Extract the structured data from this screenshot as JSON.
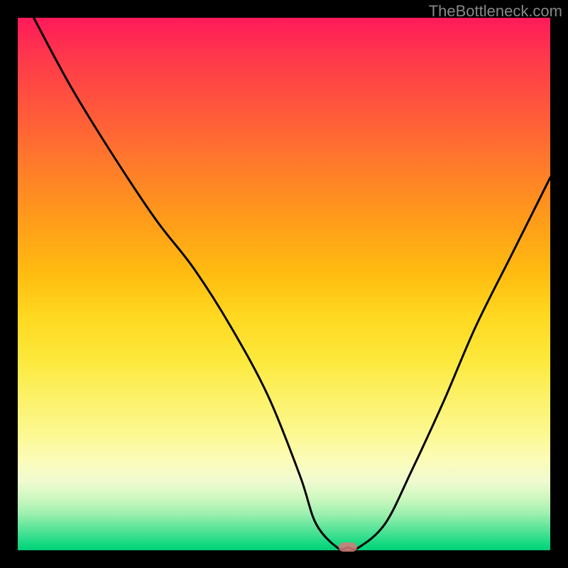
{
  "watermark": "TheBottleneck.com",
  "chart_data": {
    "type": "line",
    "title": "",
    "xlabel": "",
    "ylabel": "",
    "xlim": [
      0,
      100
    ],
    "ylim": [
      0,
      100
    ],
    "series": [
      {
        "name": "bottleneck-curve",
        "x": [
          3,
          10,
          18,
          26,
          33,
          40,
          47,
          53,
          56,
          60,
          62,
          64,
          69,
          74,
          80,
          86,
          93,
          100
        ],
        "values": [
          100,
          87,
          74,
          62,
          53,
          42,
          29,
          14,
          5,
          0.5,
          0.5,
          0.5,
          5,
          15,
          28,
          42,
          56,
          70
        ]
      }
    ],
    "marker": {
      "x": 62,
      "y": 0.5
    },
    "gradient_stops": [
      {
        "pos": 0,
        "color": "#ff1a5a"
      },
      {
        "pos": 18,
        "color": "#ff5a3a"
      },
      {
        "pos": 38,
        "color": "#ff9c1a"
      },
      {
        "pos": 56,
        "color": "#ffd820"
      },
      {
        "pos": 78,
        "color": "#fcf890"
      },
      {
        "pos": 90,
        "color": "#d0f8c0"
      },
      {
        "pos": 100,
        "color": "#00d078"
      }
    ]
  }
}
